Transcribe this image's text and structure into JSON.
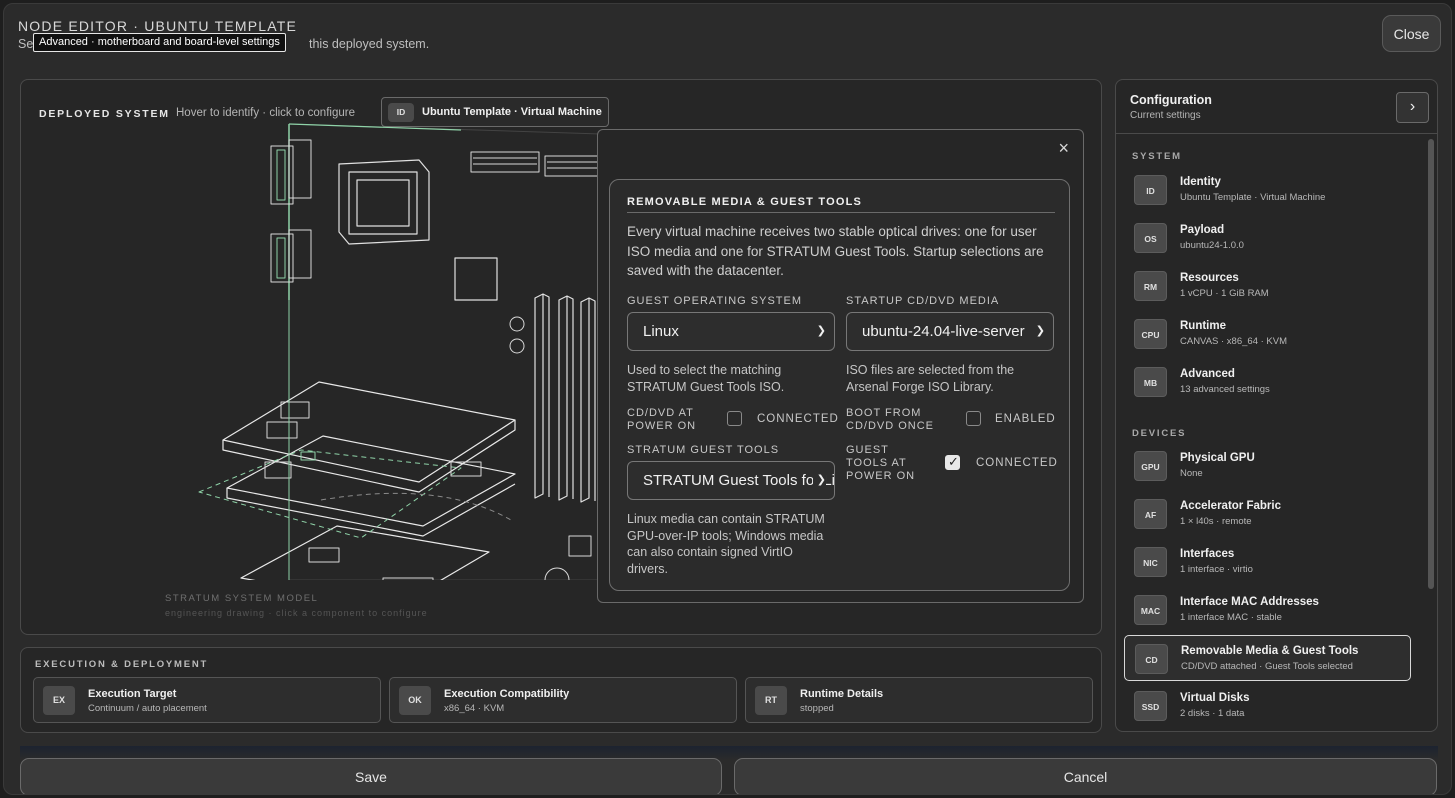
{
  "header": {
    "title": "NODE EDITOR · UBUNTU TEMPLATE",
    "subtitle_prefix": "Se",
    "subtitle_suffix": "this deployed system.",
    "tooltip": "Advanced · motherboard and board-level settings",
    "close_label": "Close"
  },
  "system": {
    "label": "DEPLOYED SYSTEM",
    "hint": "Hover to identify · click to configure",
    "id_badge": "ID",
    "id_text": "Ubuntu Template · Virtual Machine",
    "model_label": "STRATUM SYSTEM MODEL",
    "model_sub": "engineering drawing · click a component to configure"
  },
  "modal": {
    "close_icon": "×",
    "title": "REMOVABLE MEDIA & GUEST TOOLS",
    "description": "Every virtual machine receives two stable optical drives: one for user ISO media and one for STRATUM Guest Tools. Startup selections are saved with the datacenter.",
    "guest_os": {
      "label": "GUEST OPERATING SYSTEM",
      "value": "Linux",
      "help": "Used to select the matching STRATUM Guest Tools ISO."
    },
    "startup_media": {
      "label": "STARTUP CD/DVD MEDIA",
      "value": "ubuntu-24.04-live-server",
      "help": "ISO files are selected from the Arsenal Forge ISO Library."
    },
    "cd_power_on": {
      "label1": "CD/DVD AT",
      "label2": "POWER ON",
      "state": "CONNECTED",
      "checked": false
    },
    "boot_once": {
      "label1": "BOOT FROM",
      "label2": "CD/DVD ONCE",
      "state": "ENABLED",
      "checked": false
    },
    "guest_tools": {
      "label": "STRATUM GUEST TOOLS",
      "value": "STRATUM Guest Tools for Linux",
      "help": "Linux media can contain STRATUM GPU-over-IP tools; Windows media can also contain signed VirtIO drivers."
    },
    "tools_power_on": {
      "label1": "GUEST",
      "label2": "TOOLS AT",
      "label3": "POWER ON",
      "state": "CONNECTED",
      "checked": true
    }
  },
  "execution": {
    "title": "EXECUTION & DEPLOYMENT",
    "cards": [
      {
        "badge": "EX",
        "title": "Execution Target",
        "sub": "Continuum / auto placement"
      },
      {
        "badge": "OK",
        "title": "Execution Compatibility",
        "sub": "x86_64 · KVM"
      },
      {
        "badge": "RT",
        "title": "Runtime Details",
        "sub": "stopped"
      }
    ]
  },
  "config": {
    "title": "Configuration",
    "subtitle": "Current settings",
    "arrow": "›",
    "system_label": "SYSTEM",
    "devices_label": "DEVICES",
    "system_items": [
      {
        "badge": "ID",
        "title": "Identity",
        "sub": "Ubuntu Template · Virtual Machine"
      },
      {
        "badge": "OS",
        "title": "Payload",
        "sub": "ubuntu24-1.0.0"
      },
      {
        "badge": "RM",
        "title": "Resources",
        "sub": "1 vCPU · 1 GiB RAM"
      },
      {
        "badge": "CPU",
        "title": "Runtime",
        "sub": "CANVAS · x86_64 · KVM"
      },
      {
        "badge": "MB",
        "title": "Advanced",
        "sub": "13 advanced settings"
      }
    ],
    "device_items": [
      {
        "badge": "GPU",
        "title": "Physical GPU",
        "sub": "None"
      },
      {
        "badge": "AF",
        "title": "Accelerator Fabric",
        "sub": "1 × l40s · remote"
      },
      {
        "badge": "NIC",
        "title": "Interfaces",
        "sub": "1 interface · virtio"
      },
      {
        "badge": "MAC",
        "title": "Interface MAC Addresses",
        "sub": "1 interface MAC · stable"
      },
      {
        "badge": "CD",
        "title": "Removable Media & Guest Tools",
        "sub": "CD/DVD attached · Guest Tools selected"
      },
      {
        "badge": "SSD",
        "title": "Virtual Disks",
        "sub": "2 disks · 1 data"
      }
    ]
  },
  "footer": {
    "save_label": "Save",
    "cancel_label": "Cancel"
  },
  "colors": {
    "accent_green": "#8fd3a8",
    "background": "#2b2b2b"
  }
}
